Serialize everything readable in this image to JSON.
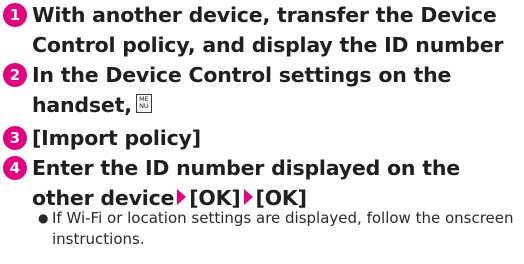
{
  "colors": {
    "accent": "#e4007f"
  },
  "steps": [
    {
      "number": "1",
      "text": "With another device, transfer the Device Control policy, and display the ID number"
    },
    {
      "number": "2",
      "text": "In the Device Control settings on the handset,",
      "key_top": "ME",
      "key_bottom": "NU"
    },
    {
      "number": "3",
      "text": "[Import policy]"
    },
    {
      "number": "4",
      "text_a": "Enter the ID number displayed on the other device",
      "text_b": "[OK]",
      "text_c": "[OK]"
    }
  ],
  "note": {
    "bullet": "●",
    "text": "If Wi-Fi or location settings are displayed, follow the onscreen instructions."
  }
}
